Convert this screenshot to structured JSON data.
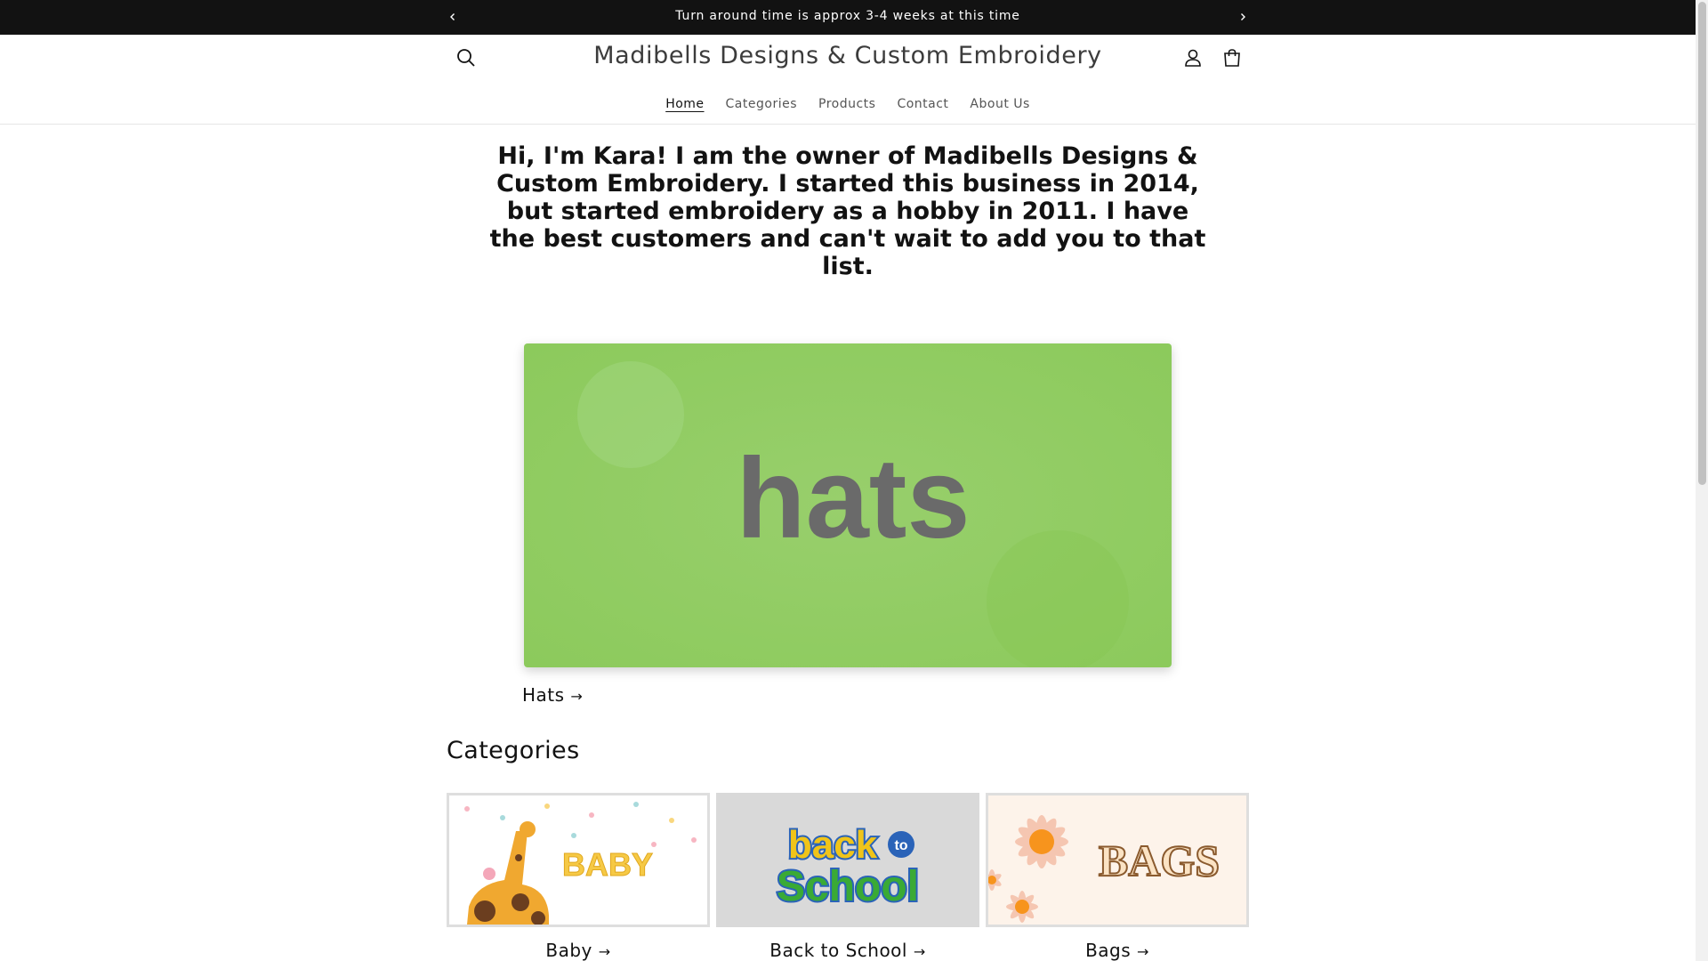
{
  "announcement": {
    "text": "Turn around time is approx 3-4 weeks at this time"
  },
  "header": {
    "store_name": "Madibells Designs & Custom Embroidery",
    "icons": {
      "search": "search-icon",
      "account": "account-icon",
      "cart": "cart-icon"
    }
  },
  "nav": {
    "items": [
      {
        "label": "Home",
        "active": true
      },
      {
        "label": "Categories"
      },
      {
        "label": "Products"
      },
      {
        "label": "Contact"
      },
      {
        "label": "About Us"
      }
    ]
  },
  "intro": {
    "text": "Hi, I'm Kara! I am the owner of Madibells Designs & Custom Embroidery. I started this business in 2014, but started embroidery as a hobby in 2011. I have the best customers and can't wait to add you to that list."
  },
  "featured": {
    "image_text": "hats",
    "link_label": "Hats",
    "bg_color": "#9fd46f",
    "text_color": "#6a6a6a"
  },
  "categories": {
    "title": "Categories",
    "items": [
      {
        "label": "Baby",
        "image_text": "BABY"
      },
      {
        "label": "Back to School",
        "image_text_1": "back",
        "image_text_2": "to",
        "image_text_3": "School"
      },
      {
        "label": "Bags",
        "image_text": "BAGS"
      }
    ]
  },
  "glyphs": {
    "arrow": "→",
    "prev": "‹",
    "next": "›"
  }
}
